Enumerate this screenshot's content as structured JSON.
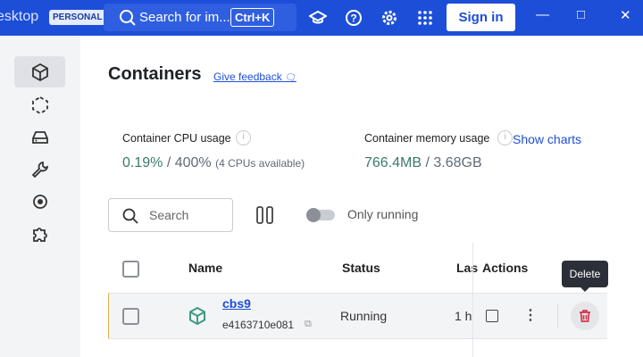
{
  "topbar": {
    "brand": "esktop",
    "plan_badge": "PERSONAL",
    "search_placeholder": "Search for im...",
    "search_shortcut": "Ctrl+K",
    "sign_in": "Sign in"
  },
  "sidebar": {
    "items": [
      "containers",
      "images",
      "volumes",
      "dev-environments",
      "builds",
      "extensions"
    ]
  },
  "page": {
    "title": "Containers",
    "feedback": "Give feedback"
  },
  "stats": {
    "cpu_label": "Container CPU usage",
    "cpu_used": "0.19%",
    "cpu_total": "/ 400%",
    "cpu_note": "(4 CPUs available)",
    "mem_label": "Container memory usage",
    "mem_used": "766.4MB",
    "mem_total": "/ 3.68GB",
    "show_charts": "Show charts",
    "info_glyph": "i"
  },
  "toolbar": {
    "search_placeholder": "Search",
    "only_running": "Only running"
  },
  "table": {
    "headers": {
      "name": "Name",
      "status": "Status",
      "last": "Las",
      "actions": "Actions"
    },
    "rows": [
      {
        "name": "cbs9",
        "id": "e4163710e081",
        "status": "Running",
        "last": "1 h"
      }
    ]
  },
  "tooltip": "Delete",
  "colors": {
    "accent": "#1d4ed8",
    "running": "#3b9c84",
    "delete": "#d6334a"
  }
}
